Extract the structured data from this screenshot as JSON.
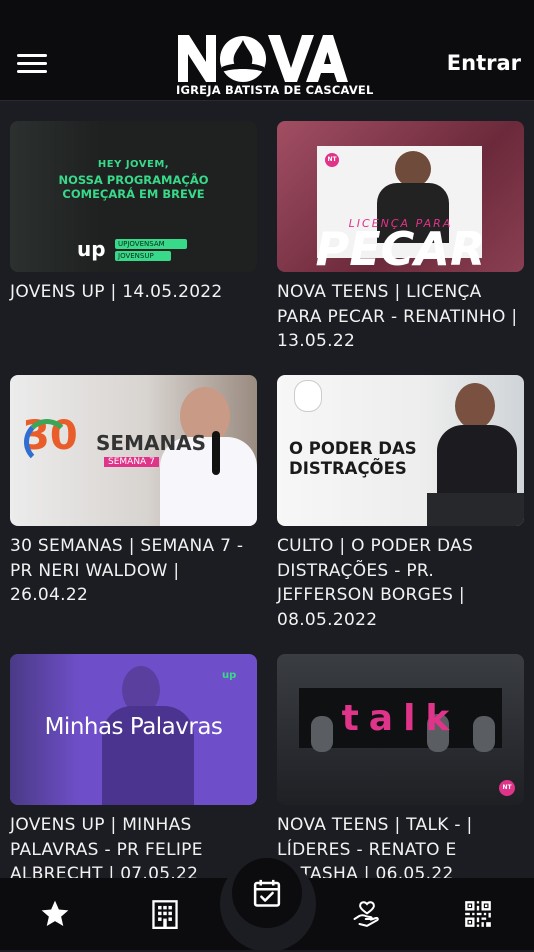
{
  "header": {
    "logo_text": "NOVA",
    "logo_subtitle": "IGREJA BATISTA DE CASCAVEL",
    "login_label": "Entrar"
  },
  "videos": [
    {
      "title": "JOVENS UP | 14.05.2022",
      "thumb_line1": "HEY JOVEM,",
      "thumb_line2": "NOSSA PROGRAMAÇÃO",
      "thumb_line3": "COMEÇARÁ EM BREVE",
      "thumb_brand": "up",
      "thumb_social1": "UPJOVENSAM",
      "thumb_social2": "JOVENSUP"
    },
    {
      "title": "NOVA TEENS | LICENÇA PARA PECAR - RENATINHO | 13.05.22",
      "thumb_small": "LICENÇA PARA",
      "thumb_big": "PECAR",
      "thumb_badge": "NT"
    },
    {
      "title": "30 SEMANAS | SEMANA 7 - PR NERI WALDOW | 26.04.22",
      "thumb_number": "30",
      "thumb_big": "SEMANAS",
      "thumb_small": "SEMANA 7"
    },
    {
      "title": "CULTO | O PODER DAS DISTRAÇÕES - PR. JEFFERSON BORGES | 08.05.2022",
      "thumb_line1": "O PODER DAS",
      "thumb_line2": "DISTRAÇÕES"
    },
    {
      "title": "JOVENS UP | MINHAS PALAVRAS - PR FELIPE ALBRECHT | 07.05.22",
      "thumb_big": "Minhas Palavras",
      "thumb_brand": "up"
    },
    {
      "title": "NOVA TEENS | TALK - | LÍDERES - RENATO E NATASHA | 06.05.22",
      "thumb_big": "talk",
      "thumb_badge": "NT"
    }
  ],
  "bottom_nav": {
    "items": [
      "favorites",
      "church",
      "checkin",
      "donate",
      "qr-code"
    ]
  },
  "colors": {
    "background": "#1c1d22",
    "bar": "#0c0c0e",
    "green_accent": "#39d98a",
    "pink_accent": "#e0338a",
    "purple_thumb": "#6f4fc9"
  }
}
